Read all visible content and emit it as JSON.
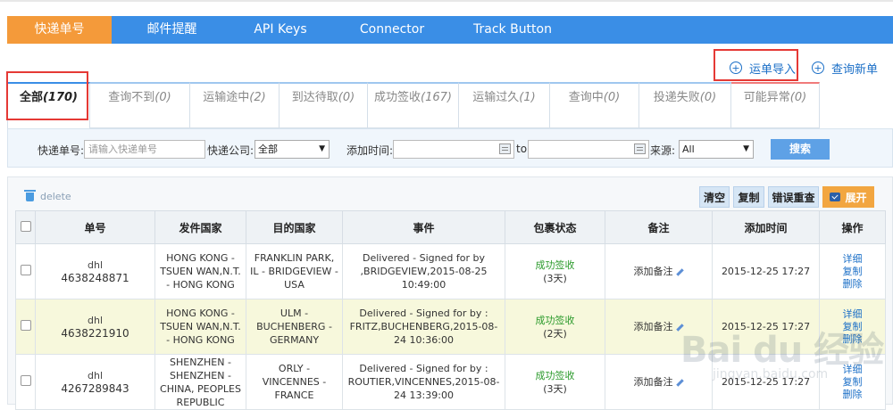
{
  "nav": [
    "快递单号",
    "邮件提醒",
    "API Keys",
    "Connector",
    "Track Button"
  ],
  "actions": {
    "import_label": "运单导入",
    "new_label": "查询新单"
  },
  "tabs": [
    {
      "label": "全部",
      "count": "(170)"
    },
    {
      "label": "查询不到",
      "count": "(0)"
    },
    {
      "label": "运输途中",
      "count": "(2)"
    },
    {
      "label": "到达待取",
      "count": "(0)"
    },
    {
      "label": "成功签收",
      "count": "(167)"
    },
    {
      "label": "运输过久",
      "count": "(1)"
    },
    {
      "label": "查询中",
      "count": "(0)"
    },
    {
      "label": "投递失败",
      "count": "(0)"
    },
    {
      "label": "可能异常",
      "count": "(0)"
    }
  ],
  "filter": {
    "tracking_label": "快递单号:",
    "tracking_placeholder": "请输入快递单号",
    "carrier_label": "快递公司:",
    "carrier_value": "全部",
    "added_label": "添加时间:",
    "to_label": "to",
    "source_label": "来源:",
    "source_value": "All",
    "search_label": "搜索"
  },
  "toolbar": {
    "delete_label": "delete",
    "clear_label": "清空",
    "copy_label": "复制",
    "requery_label": "错误重查",
    "expand_label": "展开"
  },
  "columns": [
    "单号",
    "发件国家",
    "目的国家",
    "事件",
    "包裹状态",
    "备注",
    "添加时间",
    "操作"
  ],
  "rows": [
    {
      "carrier": "dhl",
      "number": "4638248871",
      "origin": "HONG KONG - TSUEN WAN,N.T. - HONG KONG",
      "destination": "FRANKLIN PARK, IL - BRIDGEVIEW - USA",
      "event": "Delivered - Signed for by ,BRIDGEVIEW,2015-08-25 10:49:00",
      "status": "成功签收",
      "days": "(3天)",
      "note": "添加备注",
      "added": "2015-12-25 17:27",
      "ops": [
        "详细",
        "复制",
        "删除"
      ]
    },
    {
      "carrier": "dhl",
      "number": "4638221910",
      "origin": "HONG KONG - TSUEN WAN,N.T. - HONG KONG",
      "destination": "ULM - BUCHENBERG - GERMANY",
      "event": "Delivered - Signed for by : FRITZ,BUCHENBERG,2015-08-24 10:36:00",
      "status": "成功签收",
      "days": "(2天)",
      "note": "添加备注",
      "added": "2015-12-25 17:27",
      "ops": [
        "详细",
        "复制",
        "删除"
      ]
    },
    {
      "carrier": "dhl",
      "number": "4267289843",
      "origin": "SHENZHEN - SHENZHEN - CHINA, PEOPLES REPUBLIC",
      "destination": "ORLY - VINCENNES - FRANCE",
      "event": "Delivered - Signed for by : ROUTIER,VINCENNES,2015-08-24 13:39:00",
      "status": "成功签收",
      "days": "(3天)",
      "note": "添加备注",
      "added": "2015-12-25 17:27",
      "ops": [
        "详细",
        "复制",
        "删除"
      ]
    }
  ],
  "watermark": {
    "brand": "Bai du 经验",
    "url": "jingyan.baidu.com"
  }
}
